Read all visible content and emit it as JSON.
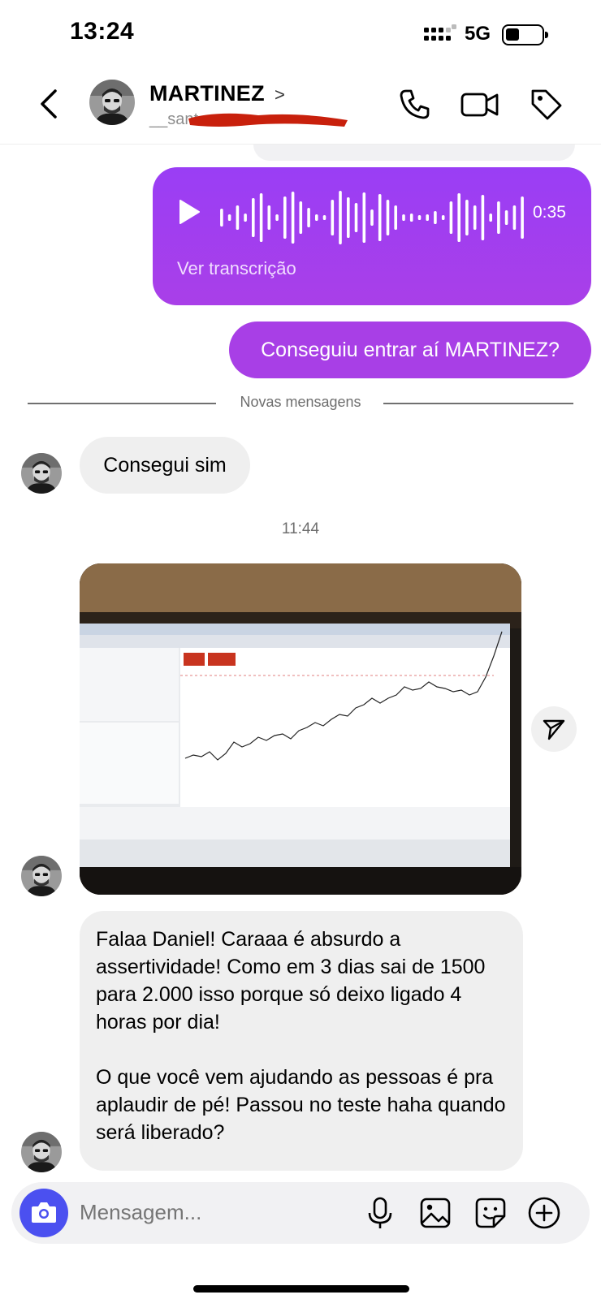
{
  "status_bar": {
    "time": "13:24",
    "network": "5G",
    "battery_icon": "battery-icon",
    "signal_icon": "signal-icon"
  },
  "header": {
    "name": "MARTINEZ",
    "chevron": ">",
    "username_partial": "__sant",
    "back_icon": "chevron-left-icon",
    "call_icon": "phone-icon",
    "video_icon": "video-icon",
    "tag_icon": "tag-icon"
  },
  "messages": {
    "voice": {
      "duration": "0:35",
      "transcription_label": "Ver transcrição",
      "play_icon": "play-icon"
    },
    "sent_text": "Conseguiu entrar aí MARTINEZ?",
    "divider_label": "Novas mensagens",
    "received_1": "Consegui sim",
    "timestamp": "11:44",
    "received_2_p1": "Falaa Daniel! Caraaa é absurdo a assertividade! Como em 3 dias sai de 1500 para 2.000 isso porque só deixo ligado 4 horas por dia!",
    "received_2_p2": "O que você vem ajudando as pessoas é pra aplaudir de pé! Passou no teste haha quando será liberado?"
  },
  "composer": {
    "placeholder": "Mensagem...",
    "camera_icon": "camera-icon",
    "mic_icon": "microphone-icon",
    "gallery_icon": "image-icon",
    "sticker_icon": "sticker-icon",
    "plus_icon": "plus-circle-icon"
  },
  "colors": {
    "sent_bubble": "#a83fe6",
    "received_bubble": "#efefef",
    "camera_button": "#4b50f0"
  }
}
